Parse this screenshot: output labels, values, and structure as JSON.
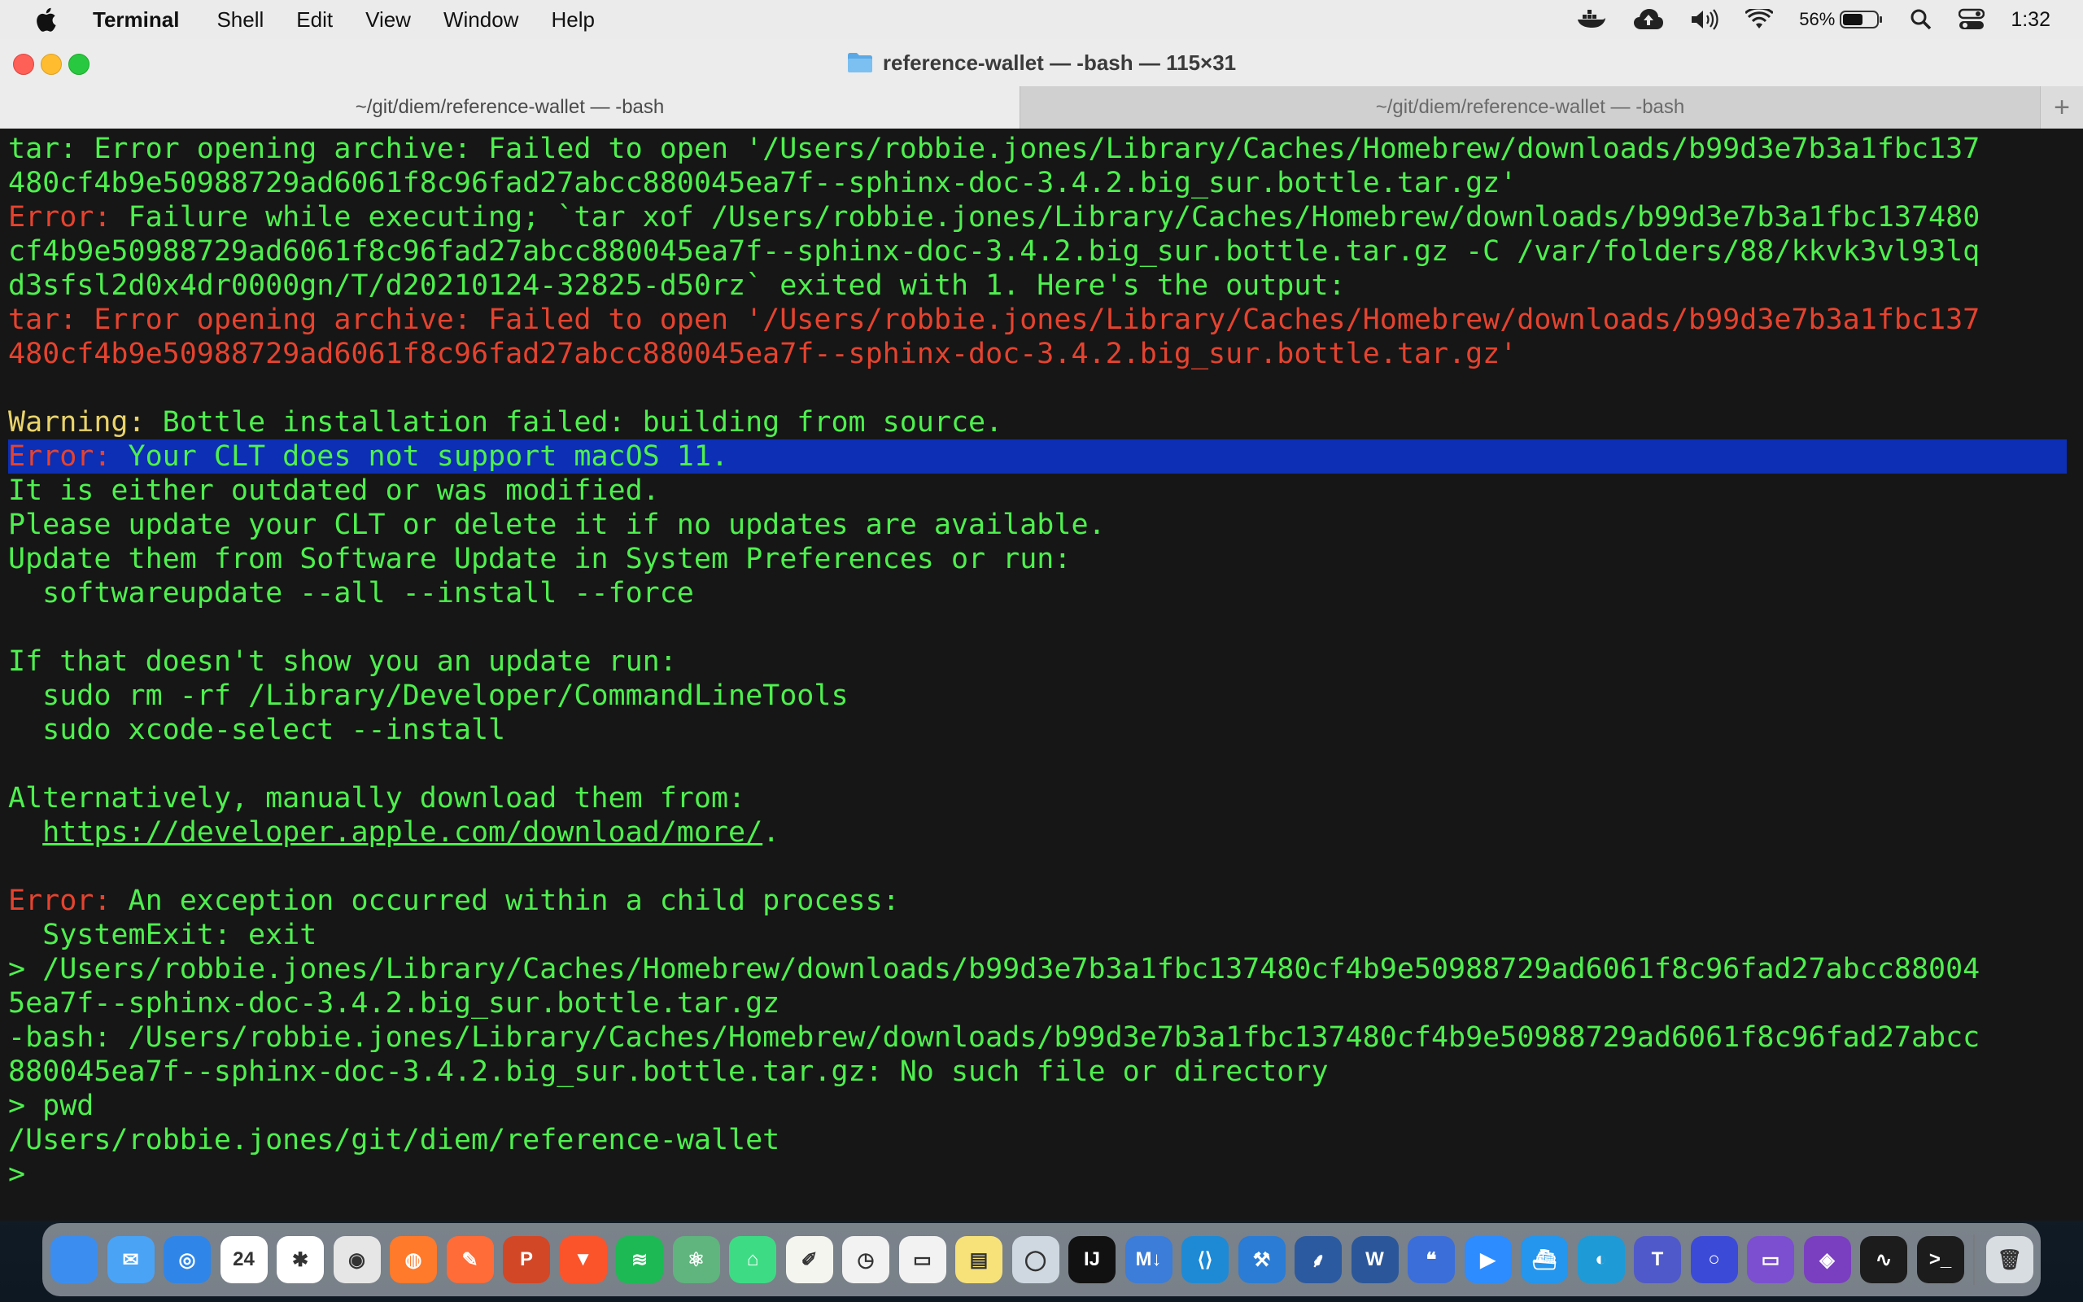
{
  "menubar": {
    "app": "Terminal",
    "items": [
      "Shell",
      "Edit",
      "View",
      "Window",
      "Help"
    ],
    "battery": "56%",
    "clock": "1:32"
  },
  "window": {
    "title": "reference-wallet — -bash — 115×31",
    "tabs": [
      {
        "label": "~/git/diem/reference-wallet — -bash",
        "active": true
      },
      {
        "label": "~/git/diem/reference-wallet — -bash",
        "active": false
      }
    ],
    "new_tab": "+"
  },
  "terminal": {
    "lines": [
      [
        {
          "t": "tar: Error opening archive: Failed to open '/Users/robbie.jones/Library/Caches/Homebrew/downloads/b99d3e7b3a1fbc137",
          "c": "grn"
        }
      ],
      [
        {
          "t": "480cf4b9e50988729ad6061f8c96fad27abcc880045ea7f--sphinx-doc-3.4.2.big_sur.bottle.tar.gz'",
          "c": "grn"
        }
      ],
      [
        {
          "t": "Error:",
          "c": "red"
        },
        {
          "t": " Failure while executing; `tar xof /Users/robbie.jones/Library/Caches/Homebrew/downloads/b99d3e7b3a1fbc137480",
          "c": "grn"
        }
      ],
      [
        {
          "t": "cf4b9e50988729ad6061f8c96fad27abcc880045ea7f--sphinx-doc-3.4.2.big_sur.bottle.tar.gz -C /var/folders/88/kkvk3vl93lq",
          "c": "grn"
        }
      ],
      [
        {
          "t": "d3sfsl2d0x4dr0000gn/T/d20210124-32825-d50rz` exited with 1. Here's the output:",
          "c": "grn"
        }
      ],
      [
        {
          "t": "tar: Error opening archive: Failed to open '/Users/robbie.jones/Library/Caches/Homebrew/downloads/b99d3e7b3a1fbc137",
          "c": "red"
        }
      ],
      [
        {
          "t": "480cf4b9e50988729ad6061f8c96fad27abcc880045ea7f--sphinx-doc-3.4.2.big_sur.bottle.tar.gz'",
          "c": "red"
        }
      ],
      [
        {
          "t": "",
          "c": "grn"
        }
      ],
      [
        {
          "t": "Warning:",
          "c": "yel"
        },
        {
          "t": " Bottle installation failed: building from source.",
          "c": "grn"
        }
      ],
      [
        {
          "t": "Error:",
          "c": "red"
        },
        {
          "t": " Your CLT does not support macOS 11.",
          "c": "grn"
        }
      ],
      [
        {
          "t": "It is either outdated or was modified.",
          "c": "grn"
        }
      ],
      [
        {
          "t": "Please update your CLT or delete it if no updates are available.",
          "c": "grn"
        }
      ],
      [
        {
          "t": "Update them from Software Update in System Preferences or run:",
          "c": "grn"
        }
      ],
      [
        {
          "t": "  softwareupdate --all --install --force",
          "c": "grn"
        }
      ],
      [
        {
          "t": "",
          "c": "grn"
        }
      ],
      [
        {
          "t": "If that doesn't show you an update run:",
          "c": "grn"
        }
      ],
      [
        {
          "t": "  sudo rm -rf /Library/Developer/CommandLineTools",
          "c": "grn"
        }
      ],
      [
        {
          "t": "  sudo xcode-select --install",
          "c": "grn"
        }
      ],
      [
        {
          "t": "",
          "c": "grn"
        }
      ],
      [
        {
          "t": "Alternatively, manually download them from:",
          "c": "grn"
        }
      ],
      [
        {
          "t": "  ",
          "c": "grn"
        },
        {
          "t": "https://developer.apple.com/download/more/",
          "c": "grn ul"
        },
        {
          "t": ".",
          "c": "grn"
        }
      ],
      [
        {
          "t": "",
          "c": "grn"
        }
      ],
      [
        {
          "t": "Error:",
          "c": "red"
        },
        {
          "t": " An exception occurred within a child process:",
          "c": "grn"
        }
      ],
      [
        {
          "t": "  SystemExit: exit",
          "c": "grn"
        }
      ],
      [
        {
          "t": "> /Users/robbie.jones/Library/Caches/Homebrew/downloads/b99d3e7b3a1fbc137480cf4b9e50988729ad6061f8c96fad27abcc88004",
          "c": "grn"
        }
      ],
      [
        {
          "t": "5ea7f--sphinx-doc-3.4.2.big_sur.bottle.tar.gz",
          "c": "grn"
        }
      ],
      [
        {
          "t": "-bash: /Users/robbie.jones/Library/Caches/Homebrew/downloads/b99d3e7b3a1fbc137480cf4b9e50988729ad6061f8c96fad27abcc",
          "c": "grn"
        }
      ],
      [
        {
          "t": "880045ea7f--sphinx-doc-3.4.2.big_sur.bottle.tar.gz: No such file or directory",
          "c": "grn"
        }
      ],
      [
        {
          "t": "> pwd",
          "c": "grn"
        }
      ],
      [
        {
          "t": "/Users/robbie.jones/git/diem/reference-wallet",
          "c": "grn"
        }
      ],
      [
        {
          "t": "> ",
          "c": "grn"
        }
      ]
    ],
    "highlight_line": 9
  },
  "dock": {
    "apps": [
      {
        "name": "finder",
        "color": "#3b8ef0",
        "glyph": ""
      },
      {
        "name": "mail",
        "color": "#4aa3f5",
        "glyph": "✉"
      },
      {
        "name": "safari",
        "color": "#2f86e8",
        "glyph": "◎"
      },
      {
        "name": "calendar",
        "color": "#ffffff",
        "glyph": "24"
      },
      {
        "name": "slack",
        "color": "#ffffff",
        "glyph": "✱"
      },
      {
        "name": "chrome",
        "color": "#e6e6e6",
        "glyph": "◉"
      },
      {
        "name": "firefox",
        "color": "#ff7a2a",
        "glyph": "◍"
      },
      {
        "name": "postman",
        "color": "#ff6c37",
        "glyph": "✎"
      },
      {
        "name": "powerpoint",
        "color": "#d24726",
        "glyph": "P"
      },
      {
        "name": "brave",
        "color": "#fb542b",
        "glyph": "▼"
      },
      {
        "name": "spotify",
        "color": "#1db954",
        "glyph": "≋"
      },
      {
        "name": "atom",
        "color": "#5fb57d",
        "glyph": "⚛"
      },
      {
        "name": "android-studio",
        "color": "#3ddc84",
        "glyph": "⌂"
      },
      {
        "name": "notes",
        "color": "#f5f5f0",
        "glyph": "✐"
      },
      {
        "name": "clock",
        "color": "#f2f2f2",
        "glyph": "◷"
      },
      {
        "name": "battery-app",
        "color": "#f2f2f2",
        "glyph": "▭"
      },
      {
        "name": "stickies",
        "color": "#f7e27a",
        "glyph": "▤"
      },
      {
        "name": "quicktime",
        "color": "#cfd8e0",
        "glyph": "◯"
      },
      {
        "name": "intellij",
        "color": "#111111",
        "glyph": "IJ"
      },
      {
        "name": "markdown",
        "color": "#3b7dd8",
        "glyph": "M↓"
      },
      {
        "name": "vscode",
        "color": "#1e8ad6",
        "glyph": "⟨⟩"
      },
      {
        "name": "xcode",
        "color": "#2a7cd4",
        "glyph": "⚒"
      },
      {
        "name": "sourcetree",
        "color": "#2c5aa0",
        "glyph": "⸙"
      },
      {
        "name": "word",
        "color": "#2b579a",
        "glyph": "W"
      },
      {
        "name": "feedback",
        "color": "#3b6ed8",
        "glyph": "❝"
      },
      {
        "name": "zoom",
        "color": "#2d8cff",
        "glyph": "▶"
      },
      {
        "name": "docker",
        "color": "#2496ed",
        "glyph": "⛴"
      },
      {
        "name": "edge",
        "color": "#1e9ad6",
        "glyph": "◐"
      },
      {
        "name": "teams",
        "color": "#5059c9",
        "glyph": "T"
      },
      {
        "name": "onelogin",
        "color": "#3c4ad8",
        "glyph": "○"
      },
      {
        "name": "archive",
        "color": "#7b4fd0",
        "glyph": "▭"
      },
      {
        "name": "visual-studio",
        "color": "#7a3fc0",
        "glyph": "◈"
      },
      {
        "name": "activity-monitor",
        "color": "#1c1c1c",
        "glyph": "∿"
      },
      {
        "name": "terminal",
        "color": "#1c1c1c",
        "glyph": ">_"
      },
      {
        "name": "trash",
        "color": "#d8dde2",
        "glyph": "🗑"
      }
    ]
  }
}
